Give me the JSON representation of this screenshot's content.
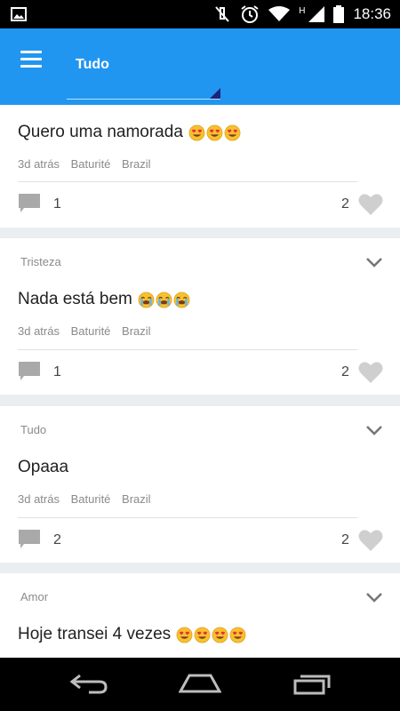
{
  "status_bar": {
    "time": "18:36",
    "network_letter": "H",
    "icons": [
      "image-icon",
      "mute-icon",
      "alarm-icon",
      "wifi-icon",
      "signal-icon",
      "battery-icon"
    ]
  },
  "app_bar": {
    "filter_selected": "Tudo",
    "color": "#2196f0"
  },
  "posts": [
    {
      "category": "",
      "text": "Quero uma namorada",
      "emoji": [
        "heart-eyes",
        "heart-eyes",
        "heart-eyes"
      ],
      "time": "3d atrás",
      "city": "Baturité",
      "country": "Brazil",
      "comments": "1",
      "likes": "2"
    },
    {
      "category": "Tristeza",
      "text": "Nada está bem",
      "emoji": [
        "crying",
        "crying",
        "crying"
      ],
      "time": "3d atrás",
      "city": "Baturité",
      "country": "Brazil",
      "comments": "1",
      "likes": "2"
    },
    {
      "category": "Tudo",
      "text": "Opaaa",
      "emoji": [],
      "time": "3d atrás",
      "city": "Baturité",
      "country": "Brazil",
      "comments": "2",
      "likes": "2"
    },
    {
      "category": "Amor",
      "text": "Hoje transei 4 vezes",
      "emoji": [
        "heart-eyes",
        "heart-eyes",
        "heart-eyes",
        "heart-eyes"
      ],
      "time": "",
      "city": "",
      "country": "",
      "comments": "",
      "likes": ""
    }
  ],
  "nav_bar": {
    "buttons": [
      "back-icon",
      "home-icon",
      "recents-icon"
    ]
  }
}
